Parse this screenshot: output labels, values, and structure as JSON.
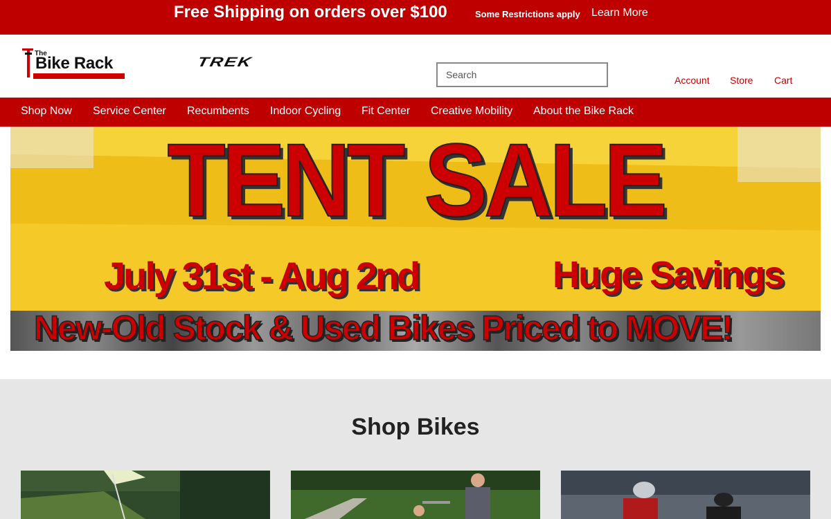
{
  "promo": {
    "main": "Free Shipping on orders over $100",
    "restrictions": "Some Restrictions apply",
    "learn_more": "Learn More"
  },
  "header": {
    "logo_the": "The",
    "logo_name": "Bike Rack",
    "brand": "TREK",
    "search_placeholder": "Search",
    "account": "Account",
    "store": "Store",
    "cart": "Cart"
  },
  "nav": {
    "items": [
      {
        "label": "Shop Now"
      },
      {
        "label": "Service Center"
      },
      {
        "label": "Recumbents"
      },
      {
        "label": "Indoor Cycling"
      },
      {
        "label": "Fit Center"
      },
      {
        "label": "Creative Mobility"
      },
      {
        "label": "About the Bike Rack"
      }
    ]
  },
  "hero": {
    "title": "TENT SALE",
    "dates": "July 31st - Aug 2nd",
    "savings": "Huge Savings",
    "stock": "New-Old Stock & Used Bikes Priced to MOVE!"
  },
  "shop": {
    "title": "Shop Bikes"
  },
  "colors": {
    "brand_red": "#bf0000",
    "hero_yellow": "#f2c21b",
    "section_gray": "#e6e6e6"
  }
}
